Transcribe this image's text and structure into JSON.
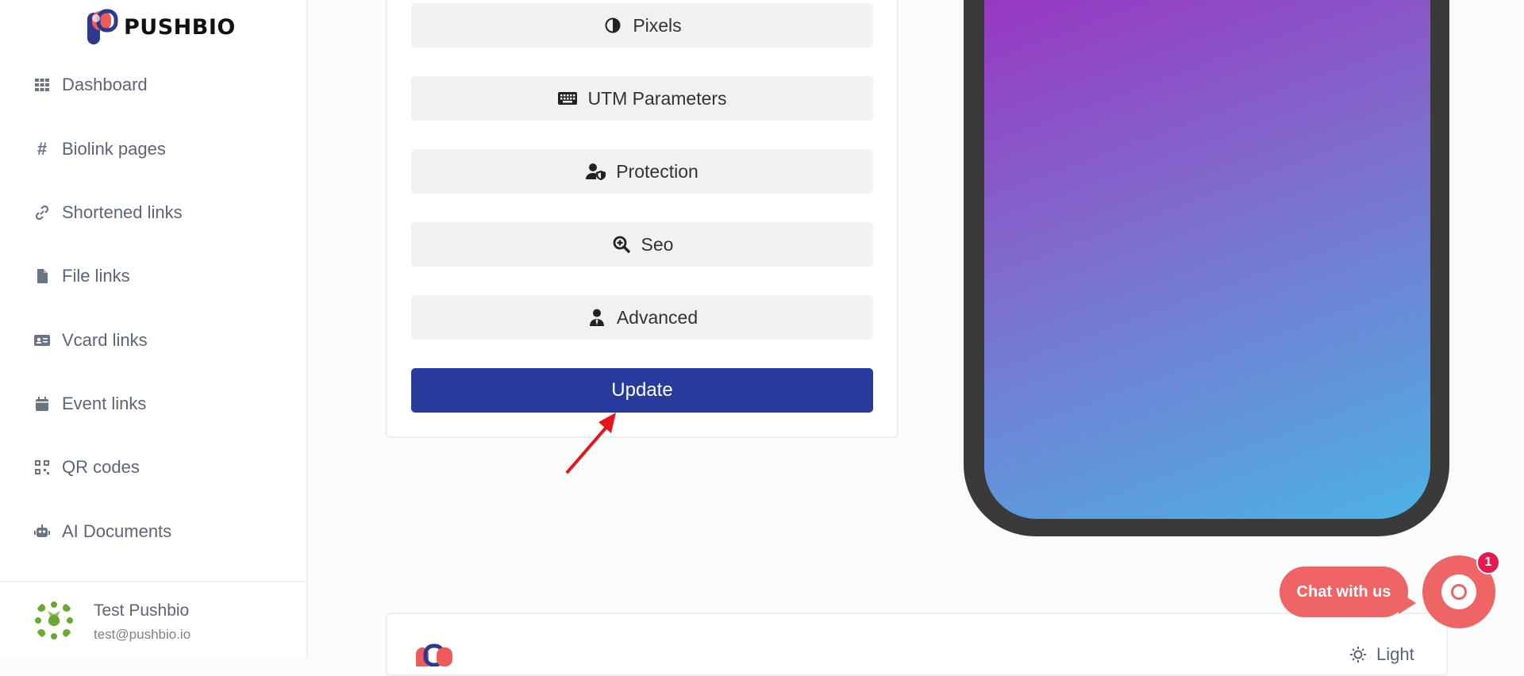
{
  "brand": {
    "name": "PUSHBIO"
  },
  "sidebar": {
    "items": [
      {
        "label": "Dashboard",
        "icon": "grid-icon"
      },
      {
        "label": "Biolink pages",
        "icon": "hashtag-icon"
      },
      {
        "label": "Shortened links",
        "icon": "link-icon"
      },
      {
        "label": "File links",
        "icon": "file-icon"
      },
      {
        "label": "Vcard links",
        "icon": "id-card-icon"
      },
      {
        "label": "Event links",
        "icon": "calendar-icon"
      },
      {
        "label": "QR codes",
        "icon": "qrcode-icon"
      },
      {
        "label": "AI Documents",
        "icon": "robot-icon"
      }
    ],
    "user": {
      "name": "Test Pushbio",
      "email": "test@pushbio.io"
    }
  },
  "main": {
    "options": [
      {
        "label": "Pixels",
        "icon": "adjust-icon"
      },
      {
        "label": "UTM Parameters",
        "icon": "keyboard-icon"
      },
      {
        "label": "Protection",
        "icon": "user-shield-icon"
      },
      {
        "label": "Seo",
        "icon": "search-plus-icon"
      },
      {
        "label": "Advanced",
        "icon": "user-tie-icon"
      }
    ],
    "update_label": "Update",
    "update_color": "#283a9b"
  },
  "footer": {
    "theme_label": "Light"
  },
  "chat": {
    "label": "Chat with us",
    "badge": "1",
    "color": "#ef6465"
  }
}
